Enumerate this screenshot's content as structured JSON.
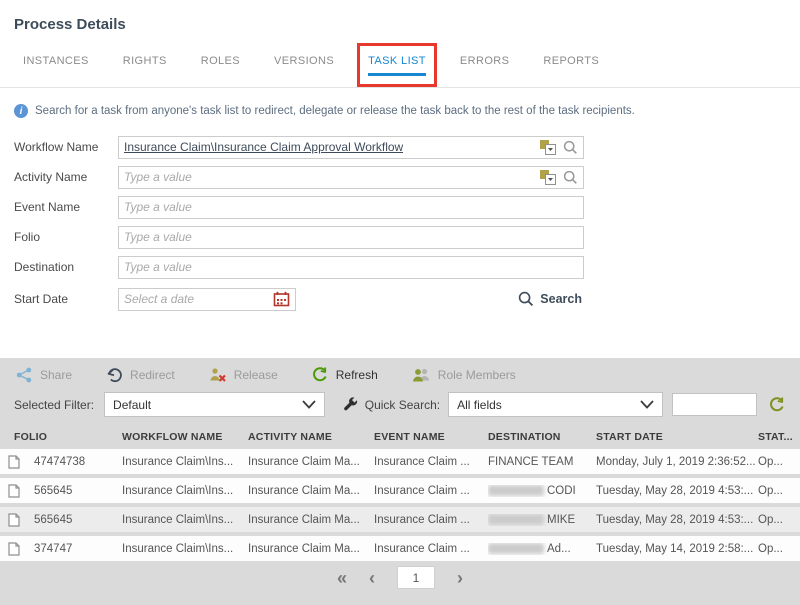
{
  "page": {
    "title": "Process Details"
  },
  "colors": {
    "active_tab": "#1787d2",
    "annotation_red": "#e6382c",
    "panel_gray": "#dadada",
    "refresh_green": "#4c9a06",
    "olive_accent": "#8a9a35",
    "calendar_red": "#b3352b",
    "share_blue": "#7fb3d5"
  },
  "tabs": [
    {
      "label": "INSTANCES"
    },
    {
      "label": "RIGHTS"
    },
    {
      "label": "ROLES"
    },
    {
      "label": "VERSIONS"
    },
    {
      "label": "TASK LIST"
    },
    {
      "label": "ERRORS"
    },
    {
      "label": "REPORTS"
    }
  ],
  "info": {
    "text": "Search for a task from anyone's task list to redirect, delegate or release the task back to the rest of the task recipients."
  },
  "form": {
    "fields": {
      "workflow": {
        "label": "Workflow Name",
        "value": "Insurance Claim\\Insurance Claim Approval Workflow"
      },
      "activity": {
        "label": "Activity Name",
        "placeholder": "Type a value"
      },
      "event": {
        "label": "Event Name",
        "placeholder": "Type a value"
      },
      "folio": {
        "label": "Folio",
        "placeholder": "Type a value"
      },
      "destination": {
        "label": "Destination",
        "placeholder": "Type a value"
      },
      "start_date": {
        "label": "Start Date",
        "placeholder": "Select a date"
      }
    },
    "search_label": "Search"
  },
  "toolbar": {
    "share": "Share",
    "redirect": "Redirect",
    "release": "Release",
    "refresh": "Refresh",
    "role_members": "Role Members"
  },
  "filter_bar": {
    "selected_filter_label": "Selected Filter:",
    "selected_filter_value": "Default",
    "quick_search_label": "Quick Search:",
    "quick_search_value": "All fields",
    "quick_search_input": ""
  },
  "table": {
    "columns": {
      "folio": "FOLIO",
      "workflow": "WORKFLOW NAME",
      "activity": "ACTIVITY NAME",
      "event": "EVENT NAME",
      "destination": "DESTINATION",
      "start_date": "START DATE",
      "status": "STAT..."
    },
    "rows": [
      {
        "folio": "47474738",
        "workflow": "Insurance Claim\\Ins...",
        "activity": "Insurance Claim Ma...",
        "event": "Insurance Claim ...",
        "destination": {
          "redacted": false,
          "visible": "FINANCE TEAM"
        },
        "start_date": "Monday, July 1, 2019 2:36:52...",
        "status": "Op..."
      },
      {
        "folio": "565645",
        "workflow": "Insurance Claim\\Ins...",
        "activity": "Insurance Claim Ma...",
        "event": "Insurance Claim ...",
        "destination": {
          "redacted": true,
          "visible": "CODI"
        },
        "start_date": "Tuesday, May 28, 2019 4:53:...",
        "status": "Op..."
      },
      {
        "folio": "565645",
        "workflow": "Insurance Claim\\Ins...",
        "activity": "Insurance Claim Ma...",
        "event": "Insurance Claim ...",
        "destination": {
          "redacted": true,
          "visible": "MIKE"
        },
        "start_date": "Tuesday, May 28, 2019 4:53:...",
        "status": "Op..."
      },
      {
        "folio": "374747",
        "workflow": "Insurance Claim\\Ins...",
        "activity": "Insurance Claim Ma...",
        "event": "Insurance Claim ...",
        "destination": {
          "redacted": true,
          "visible": "Ad..."
        },
        "start_date": "Tuesday, May 14, 2019 2:58:...",
        "status": "Op..."
      }
    ]
  },
  "pagination": {
    "first": "«",
    "prev": "‹",
    "page": "1",
    "next": "›"
  }
}
